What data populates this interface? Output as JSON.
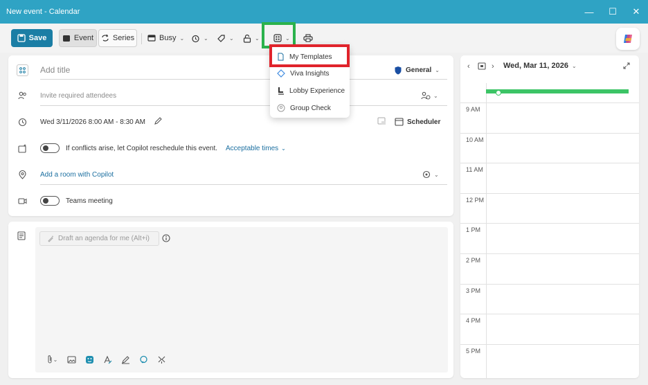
{
  "window": {
    "title": "New event - Calendar"
  },
  "toolbar": {
    "save_label": "Save",
    "event_label": "Event",
    "series_label": "Series",
    "busy_label": "Busy"
  },
  "apps_menu": {
    "items": [
      {
        "label": "My Templates",
        "icon": "template-icon"
      },
      {
        "label": "Viva Insights",
        "icon": "viva-insights-icon"
      },
      {
        "label": "Lobby Experience",
        "icon": "lobby-icon"
      },
      {
        "label": "Group Check",
        "icon": "group-check-icon"
      }
    ]
  },
  "form": {
    "title_placeholder": "Add title",
    "category": "General",
    "attendees_placeholder": "Invite required attendees",
    "datetime": "Wed 3/11/2026 8:00 AM - 8:30 AM",
    "scheduler_label": "Scheduler",
    "copilot_conflicts": "If conflicts arise, let Copilot reschedule this event.",
    "acceptable_times": "Acceptable times",
    "room_link": "Add a room with Copilot",
    "teams_meeting": "Teams meeting",
    "draft_agenda": "Draft an agenda for me (Alt+i)"
  },
  "calendar": {
    "date": "Wed, Mar 11, 2026",
    "hours": [
      "9 AM",
      "10 AM",
      "11 AM",
      "12 PM",
      "1 PM",
      "2 PM",
      "3 PM",
      "4 PM",
      "5 PM"
    ]
  },
  "colors": {
    "titlebar": "#2fa3c4",
    "accent": "#1b7ea5",
    "highlight_green": "#2bb24c",
    "highlight_red": "#e0232b",
    "now_line": "#3cc466"
  }
}
